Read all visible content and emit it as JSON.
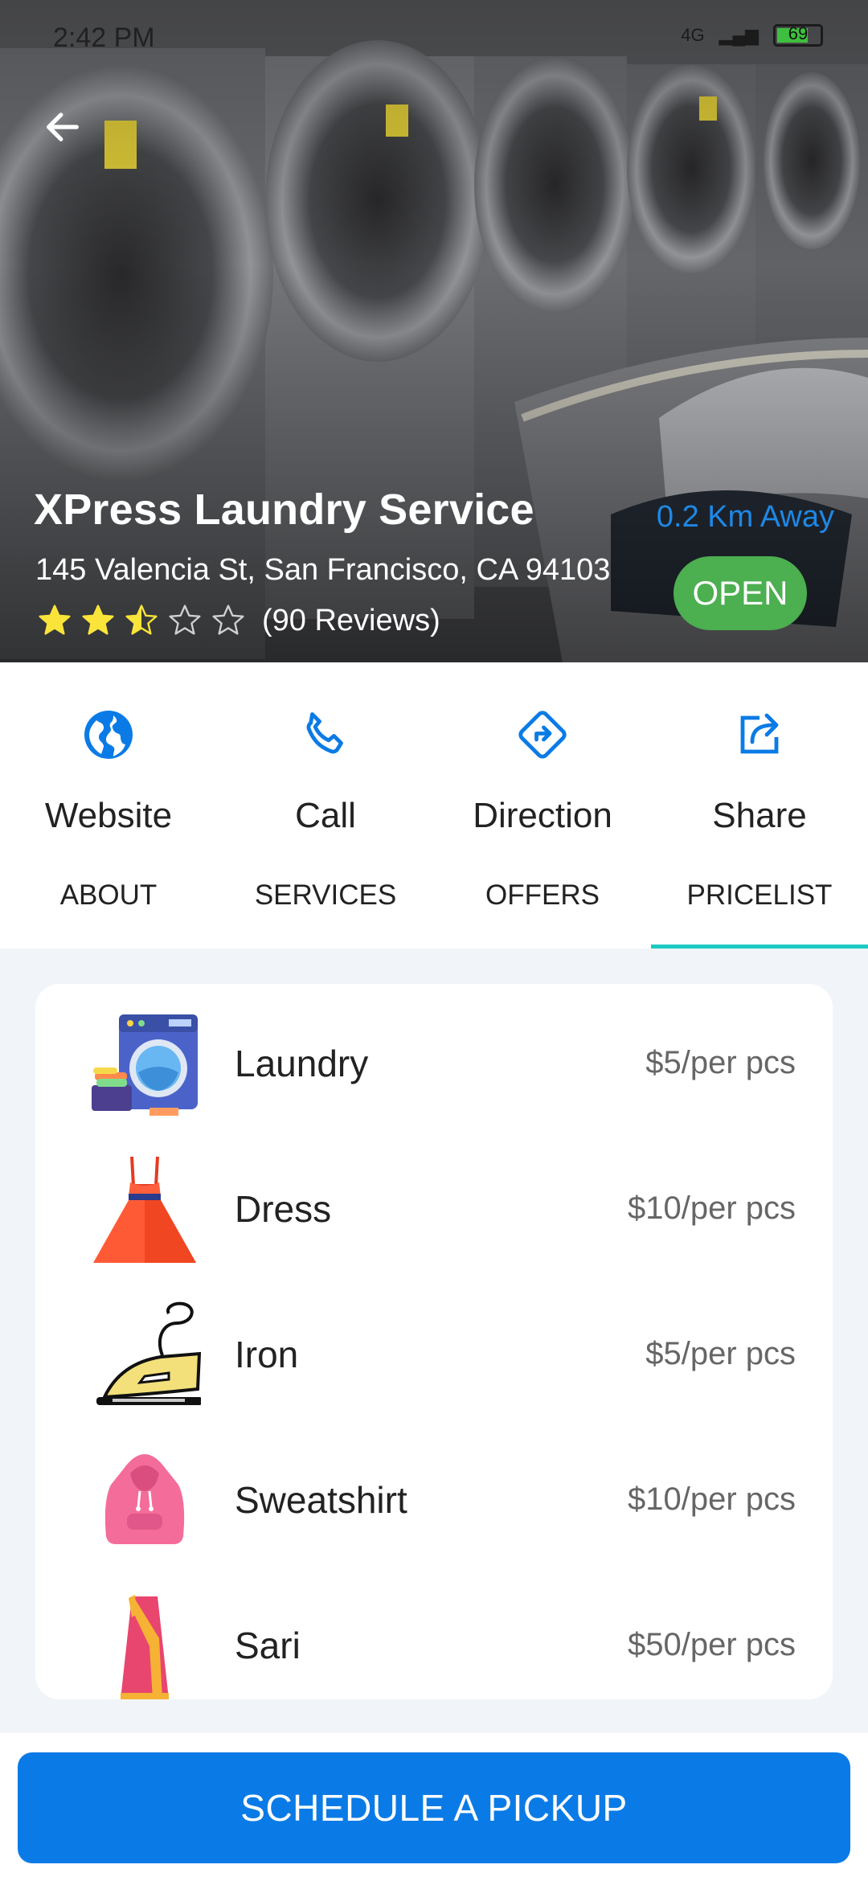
{
  "status_bar": {
    "time": "2:42 PM",
    "network": "4G",
    "battery": "69"
  },
  "shop": {
    "name": "XPress Laundry Service",
    "distance": "0.2 Km Away",
    "address": "145 Valencia St, San Francisco, CA 94103",
    "rating": 2.5,
    "rating_max": 5,
    "reviews": "(90 Reviews)",
    "status": "OPEN"
  },
  "actions": [
    {
      "label": "Website",
      "icon": "globe-icon"
    },
    {
      "label": "Call",
      "icon": "phone-icon"
    },
    {
      "label": "Direction",
      "icon": "direction-icon"
    },
    {
      "label": "Share",
      "icon": "share-icon"
    }
  ],
  "tabs": [
    {
      "label": "ABOUT"
    },
    {
      "label": "SERVICES"
    },
    {
      "label": "OFFERS"
    },
    {
      "label": "PRICELIST",
      "active": true
    }
  ],
  "pricelist": [
    {
      "name": "Laundry",
      "price": "$5/per pcs",
      "icon": "washing-machine-icon"
    },
    {
      "name": "Dress",
      "price": "$10/per pcs",
      "icon": "dress-icon"
    },
    {
      "name": "Iron",
      "price": "$5/per pcs",
      "icon": "iron-icon"
    },
    {
      "name": "Sweatshirt",
      "price": "$10/per pcs",
      "icon": "sweatshirt-icon"
    },
    {
      "name": "Sari",
      "price": "$50/per pcs",
      "icon": "sari-icon"
    }
  ],
  "cta": {
    "label": "SCHEDULE A PICKUP"
  },
  "colors": {
    "primary": "#0a7be6",
    "open": "#4caf50",
    "tab_indicator": "#1ec9c0",
    "star": "#fbe43a"
  }
}
